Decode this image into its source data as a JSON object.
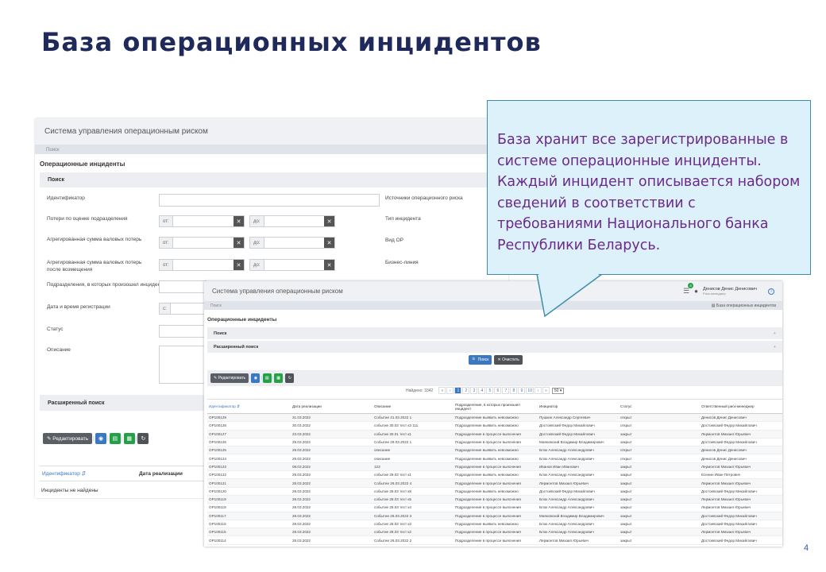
{
  "slide": {
    "title": "База операционных инцидентов",
    "page_number": "4"
  },
  "callout": {
    "text": "База хранит все зарегистрированные в системе операционные инциденты. Каждый инцидент описывается набором сведений в соответствии с требованиями Национального банка Республики Беларусь."
  },
  "back": {
    "app_title": "Система управления операционным риском",
    "breadcrumb": "Поиск",
    "section_title": "Операционные инциденты",
    "search_panel": "Поиск",
    "fields": {
      "identifier": "Идентификатор",
      "loss_estimate": "Потери по оценке подразделения",
      "gross_losses": "Агрегированная сумма валовых потерь",
      "gross_after": "Агрегированная сумма валовых потерь после возмещения",
      "divisions": "Подразделения, в которых произошел инцидент",
      "reg_date": "Дата и время регистрации",
      "status": "Статус",
      "description": "Описание",
      "risk_sources": "Источники операционного риска",
      "incident_type": "Тип инцидента",
      "or_type": "Вид ОР",
      "business_line": "Бизнес-линия"
    },
    "from_prefix": "от:",
    "to_prefix": "до:",
    "date_prefix": "с:",
    "advanced_panel": "Расширенный поиск",
    "edit_button": "Редактировать",
    "col_id": "Идентификатор",
    "col_date": "Дата реализации",
    "no_results": "Инциденты не найдены"
  },
  "front": {
    "app_title": "Система управления операционным риском",
    "user_name": "Денисов Денис Денисович",
    "user_role": "Риск-менеджер",
    "notif_count": "8",
    "breadcrumb": "Поиск",
    "breadcrumb_right": "База операционных инцидентов",
    "section_title": "Операционные инциденты",
    "search_panel": "Поиск",
    "advanced_panel": "Расширенный поиск",
    "search_btn": "Поиск",
    "clear_btn": "Очистить",
    "edit_button": "Редактировать",
    "found": "Найдено: 3342",
    "pages": [
      "«",
      "‹",
      "1",
      "2",
      "3",
      "4",
      "5",
      "6",
      "7",
      "8",
      "9",
      "10",
      "›",
      "»"
    ],
    "page_size": "50",
    "headers": [
      "Идентификатор",
      "Дата реализации",
      "Описание",
      "Подразделение, в которых произошел инцидент",
      "Инициатор",
      "Статус",
      "Ответственный риск-менеджер"
    ],
    "rows": [
      [
        "OP100129",
        "31.03.2022",
        "Событие 31.03.2022 1",
        "Подразделение выявить невозможно",
        "Пушкин Александр Сергеевич",
        "открыт",
        "Денисов Денис Денисович"
      ],
      [
        "OP100128",
        "30.03.2022",
        "событие 30.03 тест к3 111.",
        "Подразделение выявить невозможно",
        "Достоевский Федор Михайлович",
        "открыт",
        "Достоевский Федор Михайлович"
      ],
      [
        "OP100127",
        "23.03.2022",
        "событие 30.01 тест к1",
        "Подразделение в процессе выяснения",
        "Достоевский Федор Михайлович",
        "закрыт",
        "Лермонтов Михаил Юрьевич"
      ],
      [
        "OP100126",
        "29.03.2022",
        "Событие 29.03.2022 1",
        "Подразделение в процессе выяснения",
        "Маяковский Владимир Владимирович",
        "закрыт",
        "Достоевский Федор Михайлович"
      ],
      [
        "OP100125",
        "29.03.2022",
        "описание",
        "Подразделение выявить невозможно",
        "Блок Александр Александрович",
        "открыт",
        "Денисов Денис Денисович"
      ],
      [
        "OP100124",
        "29.03.2022",
        "описание",
        "Подразделение выявить невозможно",
        "Блок Александр Александрович",
        "открыт",
        "Денисов Денис Денисович"
      ],
      [
        "OP100123",
        "08.03.2022",
        "123",
        "Подразделение в процессе выяснения",
        "Иванов Иван Иванович",
        "закрыт",
        "Лермонтов Михаил Юрьевич"
      ],
      [
        "OP100122",
        "29.03.2022",
        "событие 29.03 тест к1",
        "Подразделение выявить невозможно",
        "Блок Александр Александрович",
        "закрыт",
        "Есенин Иван Петрович"
      ],
      [
        "OP100121",
        "28.03.2022",
        "Событие 28.03.2022 4",
        "Подразделение в процессе выяснения",
        "Лермонтов Михаил Юрьевич",
        "закрыт",
        "Лермонтов Михаил Юрьевич"
      ],
      [
        "OP100120",
        "28.03.2022",
        "событие 28.03 тест к8",
        "Подразделение выявить невозможно",
        "Достоевский Федор Михайлович",
        "закрыт",
        "Достоевский Федор Михайлович"
      ],
      [
        "OP100119",
        "28.03.2022",
        "событие 28.03 тест к5",
        "Подразделение в процессе выяснения",
        "Блок Александр Александрович",
        "закрыт",
        "Лермонтов Михаил Юрьевич"
      ],
      [
        "OP100118",
        "28.03.2022",
        "событие 28.03 тест к4",
        "Подразделение в процессе выяснения",
        "Блок Александр Александрович",
        "закрыт",
        "Лермонтов Михаил Юрьевич"
      ],
      [
        "OP100117",
        "28.03.2022",
        "Событие 28.03.2022 3",
        "Подразделение в процессе выяснения",
        "Маяковский Владимир Владимирович",
        "закрыт",
        "Достоевский Федор Михайлович"
      ],
      [
        "OP100116",
        "28.03.2022",
        "событие 28.03 тест к3",
        "Подразделение выявить невозможно",
        "Блок Александр Александрович",
        "закрыт",
        "Достоевский Федор Михайлович"
      ],
      [
        "OP100115",
        "28.03.2022",
        "событие 28.03 тест к2",
        "Подразделение в процессе выяснения",
        "Блок Александр Александрович",
        "закрыт",
        "Лермонтов Михаил Юрьевич"
      ],
      [
        "OP100114",
        "28.03.2022",
        "Событие 28.03.2022 2",
        "Подразделение в процессе выяснения",
        "Лермонтов Михаил Юрьевич",
        "закрыт",
        "Достоевский Федор Михайлович"
      ]
    ]
  },
  "colors": {
    "title": "#1f2a5a",
    "callout_bg": "#dcf1f9",
    "callout_border": "#3e8cab",
    "callout_text": "#6b2a8b",
    "link": "#3b78c2"
  }
}
